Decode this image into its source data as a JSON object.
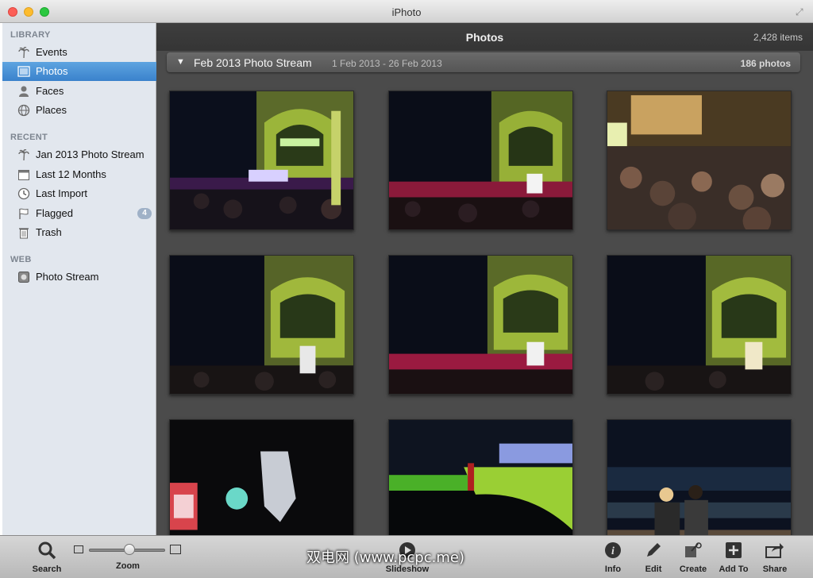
{
  "window": {
    "title": "iPhoto"
  },
  "sidebar": {
    "sections": [
      {
        "title": "LIBRARY"
      },
      {
        "title": "RECENT"
      },
      {
        "title": "WEB"
      }
    ],
    "items": [
      {
        "label": "Events",
        "icon": "palm-tree-icon",
        "selected": false
      },
      {
        "label": "Photos",
        "icon": "photo-icon",
        "selected": true
      },
      {
        "label": "Faces",
        "icon": "face-silhouette-icon",
        "selected": false
      },
      {
        "label": "Places",
        "icon": "globe-icon",
        "selected": false
      },
      {
        "label": "Jan 2013 Photo Stream",
        "icon": "palm-tree-icon",
        "selected": false
      },
      {
        "label": "Last 12 Months",
        "icon": "calendar-icon",
        "selected": false
      },
      {
        "label": "Last Import",
        "icon": "clock-icon",
        "selected": false
      },
      {
        "label": "Flagged",
        "icon": "flag-icon",
        "selected": false,
        "badge": "4"
      },
      {
        "label": "Trash",
        "icon": "trash-icon",
        "selected": false
      },
      {
        "label": "Photo Stream",
        "icon": "photo-stream-icon",
        "selected": false
      }
    ]
  },
  "main": {
    "title": "Photos",
    "item_count": "2,428 items",
    "event": {
      "title": "Feb 2013 Photo Stream",
      "dates": "1 Feb 2013 - 26 Feb 2013",
      "count": "186 photos"
    }
  },
  "toolbar": {
    "search": "Search",
    "zoom": "Zoom",
    "slideshow": "Slideshow",
    "info": "Info",
    "edit": "Edit",
    "create": "Create",
    "add_to": "Add To",
    "share": "Share"
  },
  "watermark": "双电网 (www.pcpc.me)",
  "colors": {
    "selection": "#3a82cc",
    "main_bg": "#4b4b4b",
    "sidebar_bg": "#e2e7ee"
  }
}
